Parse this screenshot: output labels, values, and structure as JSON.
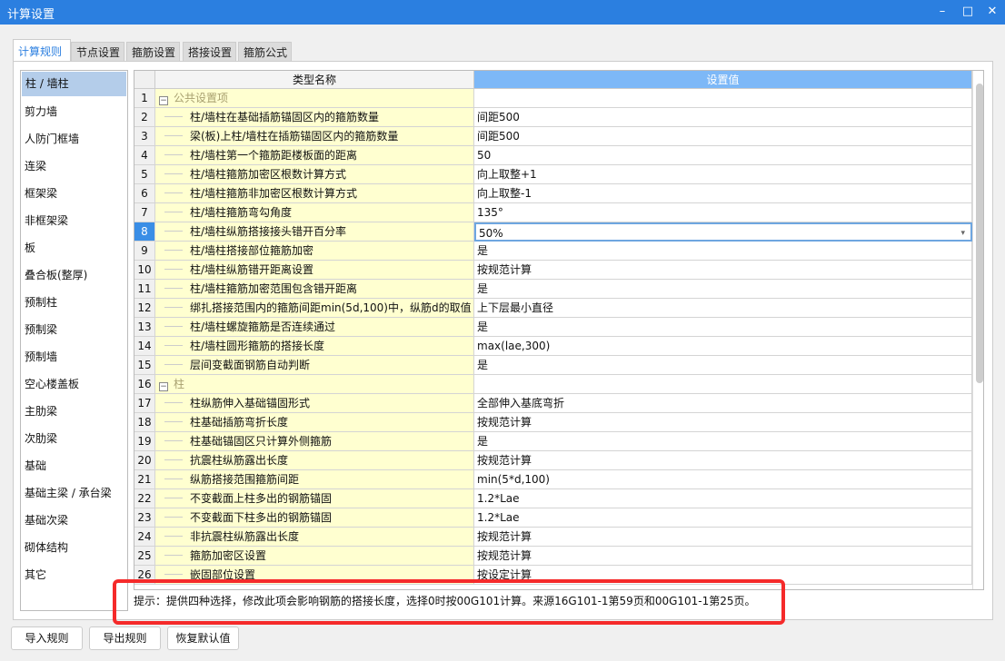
{
  "window": {
    "title": "计算设置",
    "controls": [
      "minimize-icon",
      "maximize-icon",
      "close-icon"
    ]
  },
  "tabs": [
    "计算规则",
    "节点设置",
    "箍筋设置",
    "搭接设置",
    "箍筋公式"
  ],
  "sidebar": {
    "selected": "柱 / 墙柱",
    "items": [
      "柱 / 墙柱",
      "剪力墙",
      "人防门框墙",
      "连梁",
      "框架梁",
      "非框架梁",
      "板",
      "叠合板(整厚)",
      "预制柱",
      "预制梁",
      "预制墙",
      "空心楼盖板",
      "主肋梁",
      "次肋梁",
      "基础",
      "基础主梁 / 承台梁",
      "基础次梁",
      "砌体结构",
      "其它"
    ]
  },
  "grid": {
    "headers": {
      "name": "类型名称",
      "value": "设置值"
    },
    "current_row": 8,
    "rows": [
      {
        "n": "1",
        "name": "公共设置项",
        "value": "",
        "group": true
      },
      {
        "n": "2",
        "name": "柱/墙柱在基础插筋锚固区内的箍筋数量",
        "value": "间距500"
      },
      {
        "n": "3",
        "name": "梁(板)上柱/墙柱在插筋锚固区内的箍筋数量",
        "value": "间距500"
      },
      {
        "n": "4",
        "name": "柱/墙柱第一个箍筋距楼板面的距离",
        "value": "50"
      },
      {
        "n": "5",
        "name": "柱/墙柱箍筋加密区根数计算方式",
        "value": "向上取整+1"
      },
      {
        "n": "6",
        "name": "柱/墙柱箍筋非加密区根数计算方式",
        "value": "向上取整-1"
      },
      {
        "n": "7",
        "name": "柱/墙柱箍筋弯勾角度",
        "value": "135°"
      },
      {
        "n": "8",
        "name": "柱/墙柱纵筋搭接接头错开百分率",
        "value": "50%"
      },
      {
        "n": "9",
        "name": "柱/墙柱搭接部位箍筋加密",
        "value": "是"
      },
      {
        "n": "10",
        "name": "柱/墙柱纵筋错开距离设置",
        "value": "按规范计算"
      },
      {
        "n": "11",
        "name": "柱/墙柱箍筋加密范围包含错开距离",
        "value": "是"
      },
      {
        "n": "12",
        "name": "绑扎搭接范围内的箍筋间距min(5d,100)中，纵筋d的取值",
        "value": "上下层最小直径"
      },
      {
        "n": "13",
        "name": "柱/墙柱螺旋箍筋是否连续通过",
        "value": "是"
      },
      {
        "n": "14",
        "name": "柱/墙柱圆形箍筋的搭接长度",
        "value": "max(lae,300)"
      },
      {
        "n": "15",
        "name": "层间变截面钢筋自动判断",
        "value": "是"
      },
      {
        "n": "16",
        "name": "柱",
        "value": "",
        "group": true
      },
      {
        "n": "17",
        "name": "柱纵筋伸入基础锚固形式",
        "value": "全部伸入基底弯折"
      },
      {
        "n": "18",
        "name": "柱基础插筋弯折长度",
        "value": "按规范计算"
      },
      {
        "n": "19",
        "name": "柱基础锚固区只计算外侧箍筋",
        "value": "是"
      },
      {
        "n": "20",
        "name": "抗震柱纵筋露出长度",
        "value": "按规范计算"
      },
      {
        "n": "21",
        "name": "纵筋搭接范围箍筋间距",
        "value": "min(5*d,100)"
      },
      {
        "n": "22",
        "name": "不变截面上柱多出的钢筋锚固",
        "value": "1.2*Lae"
      },
      {
        "n": "23",
        "name": "不变截面下柱多出的钢筋锚固",
        "value": "1.2*Lae"
      },
      {
        "n": "24",
        "name": "非抗震柱纵筋露出长度",
        "value": "按规范计算"
      },
      {
        "n": "25",
        "name": "箍筋加密区设置",
        "value": "按规范计算"
      },
      {
        "n": "26",
        "name": "嵌固部位设置",
        "value": "按设定计算"
      }
    ]
  },
  "hint": "提示：提供四种选择，修改此项会影响钢筋的搭接长度，选择0时按00G101计算。来源16G101-1第59页和00G101-1第25页。",
  "buttons": {
    "import": "导入规则",
    "export": "导出规则",
    "restore": "恢复默认值"
  },
  "colors": {
    "titlebar": "#2b7fe0",
    "name_column": "#ffffd0",
    "value_header": "#7db8f7",
    "highlight_box": "#f52a2a"
  }
}
